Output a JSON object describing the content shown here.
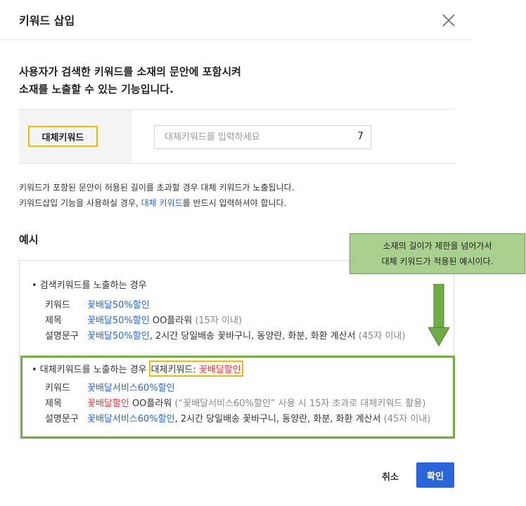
{
  "dialog": {
    "title": "키워드 삽입",
    "close_icon": "close-icon"
  },
  "intro": {
    "line1": "사용자가 검색한 키워드를 소재의 문안에 포함시켜",
    "line2": "소재를 노출할 수 있는 기능입니다."
  },
  "field": {
    "label": "대체키워드",
    "placeholder": "대체키워드를 입력하세요",
    "value": "",
    "char_count": "7"
  },
  "notice": {
    "line1": "키워드가 포함된 문안이 허용된 길이를 초과할 경우 대체 키워드가 노출됩니다.",
    "line2_prefix": "키워드삽입 기능을 사용하실 경우, ",
    "line2_link": "대체 키워드",
    "line2_suffix": "를 반드시 입력하셔야 합니다."
  },
  "example": {
    "title": "예시",
    "section1": {
      "head": "• 검색키워드를 노출하는 경우",
      "rows": [
        {
          "label": "키워드",
          "value_blue": "꽃배달50%할인",
          "rest": "",
          "note": ""
        },
        {
          "label": "제목",
          "value_blue": "꽃배달50%할인",
          "rest": " OO플라워",
          "note": " (15자 이내)"
        },
        {
          "label": "설명문구",
          "value_blue": "꽃배달50%할인",
          "rest": ", 2시간 당일배송 꽃바구니, 동양란, 화분, 화환 계산서",
          "note": " (45자 이내)"
        }
      ]
    },
    "section2": {
      "head": "• 대체키워드를 노출하는 경우",
      "highlight_label": "대체키워드: ",
      "highlight_value": "꽃배달할인",
      "rows": [
        {
          "label": "키워드",
          "value_blue": "꽃배달서비스60%할인",
          "rest": "",
          "note": ""
        },
        {
          "label": "제목",
          "value_red": "꽃배달할인",
          "rest": " OO플라워",
          "note": " (“꽃배달서비스60%할인” 사용 시 15자 초과로 대체키워드 활용)"
        },
        {
          "label": "설명문구",
          "value_blue": "꽃배달서비스60%할인",
          "rest": ", 2시간 당일배송 꽃바구니, 동양란, 화분, 화환 계산서",
          "note": " (45자 이내)"
        }
      ]
    }
  },
  "callout": {
    "line1": "소재의 길이가 제한을 넘어가서",
    "line2": "대체 키워드가 적용된 예시이다."
  },
  "footer": {
    "cancel_label": "취소",
    "ok_label": "확인"
  },
  "colors": {
    "accent_blue": "#2a66d9",
    "highlight_yellow": "#f5b800",
    "callout_green": "#a9d08e",
    "frame_green": "#70ad47",
    "red": "#e53935"
  }
}
